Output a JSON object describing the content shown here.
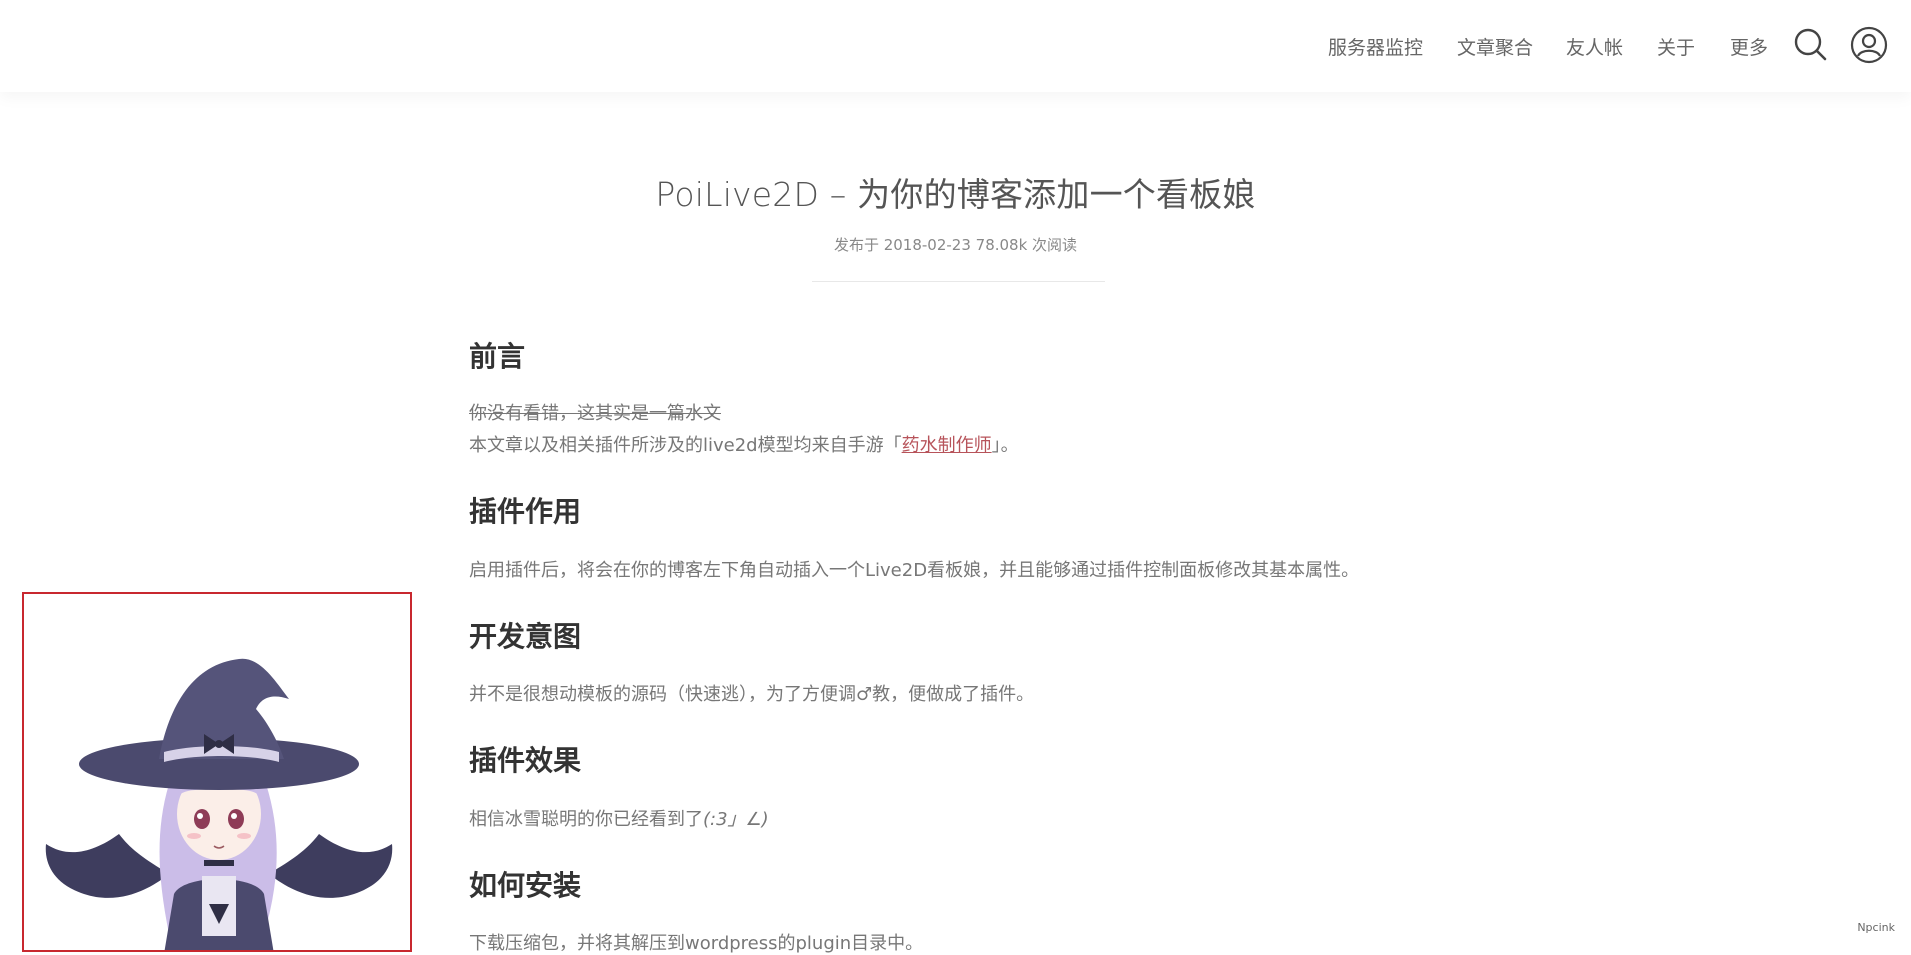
{
  "nav": {
    "items": [
      {
        "label": "服务器监控"
      },
      {
        "label": "文章聚合"
      },
      {
        "label": "友人帐"
      },
      {
        "label": "关于"
      },
      {
        "label": "更多"
      }
    ],
    "search_icon": "search-icon",
    "user_icon": "user-icon"
  },
  "post": {
    "title": "PoiLive2D – 为你的博客添加一个看板娘",
    "meta": "发布于 2018-02-23  78.08k 次阅读"
  },
  "sections": {
    "s1": {
      "heading": "前言",
      "strike_text": "你没有看错，这其实是一篇水文",
      "line_prefix": "本文章以及相关插件所涉及的live2d模型均来自手游「",
      "link_text": "药水制作师",
      "line_suffix": "」。"
    },
    "s2": {
      "heading": "插件作用",
      "text": "启用插件后，将会在你的博客左下角自动插入一个Live2D看板娘，并且能够通过插件控制面板修改其基本属性。"
    },
    "s3": {
      "heading": "开发意图",
      "text": "并不是很想动模板的源码（快速逃），为了方便调♂教，便做成了插件。"
    },
    "s4": {
      "heading": "插件效果",
      "text_prefix": "相信冰雪聪明的你已经看到了",
      "kaomoji": "(:3」∠)"
    },
    "s5": {
      "heading": "如何安装",
      "text": "下载压缩包，并将其解压到wordpress的plugin目录中。"
    }
  },
  "widget": {
    "name": "live2d-witch-character"
  },
  "corner": {
    "label": "Npcink"
  },
  "colors": {
    "link": "#b7535a",
    "widget_border": "#c8282f",
    "witch_hat": "#4b4a6e",
    "hair": "#cbbde8"
  }
}
